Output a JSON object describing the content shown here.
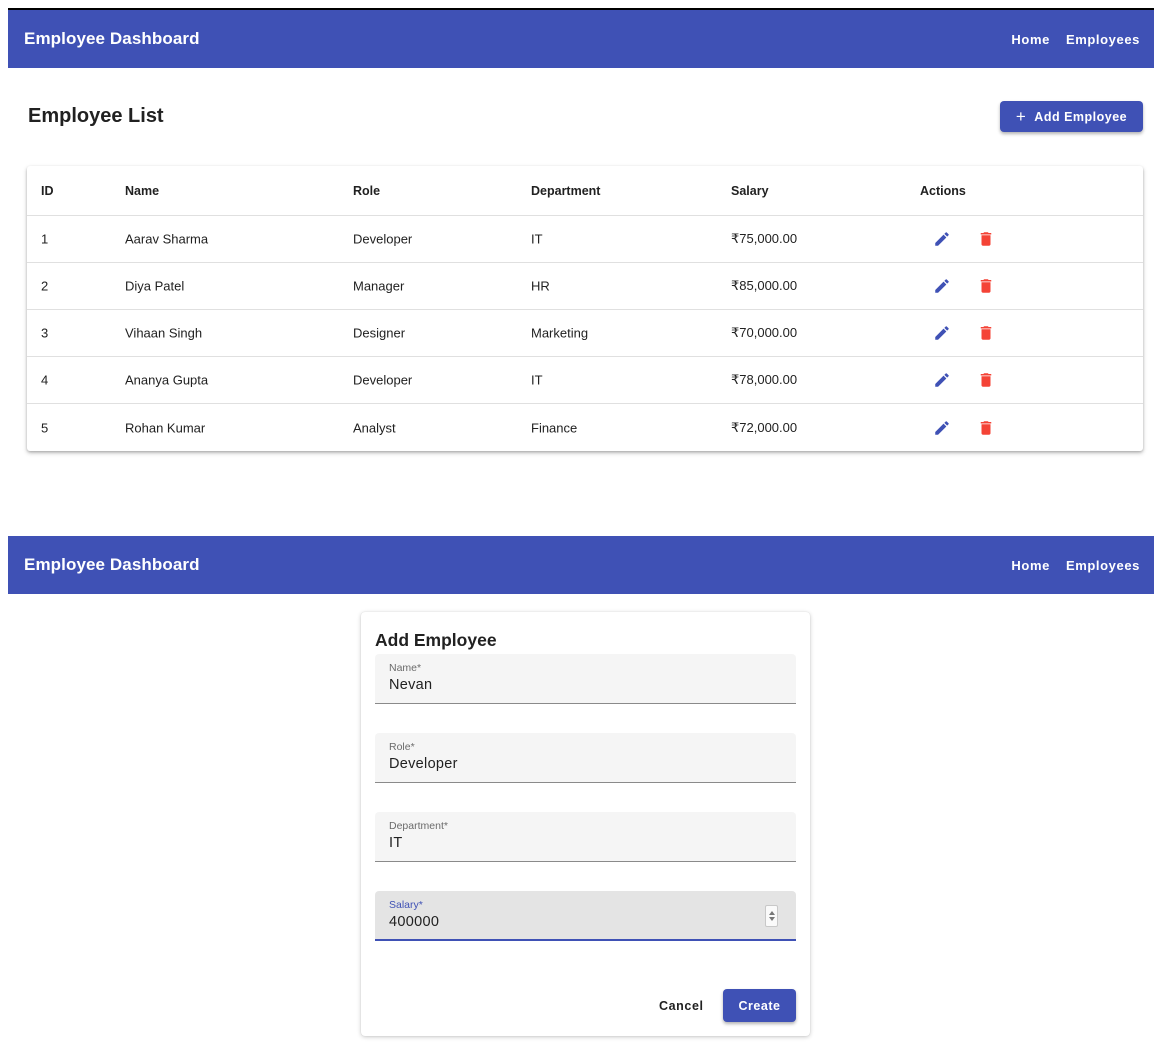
{
  "app": {
    "brand": "Employee Dashboard",
    "nav": [
      {
        "label": "Home"
      },
      {
        "label": "Employees"
      }
    ],
    "accent_color": "#3f51b5"
  },
  "list_page": {
    "title": "Employee List",
    "add_button_label": "Add Employee",
    "add_button_icon": "plus-icon",
    "columns": [
      "ID",
      "Name",
      "Role",
      "Department",
      "Salary",
      "Actions"
    ],
    "rows": [
      {
        "id": "1",
        "name": "Aarav Sharma",
        "role": "Developer",
        "department": "IT",
        "salary": "₹75,000.00"
      },
      {
        "id": "2",
        "name": "Diya Patel",
        "role": "Manager",
        "department": "HR",
        "salary": "₹85,000.00"
      },
      {
        "id": "3",
        "name": "Vihaan Singh",
        "role": "Designer",
        "department": "Marketing",
        "salary": "₹70,000.00"
      },
      {
        "id": "4",
        "name": "Ananya Gupta",
        "role": "Developer",
        "department": "IT",
        "salary": "₹78,000.00"
      },
      {
        "id": "5",
        "name": "Rohan Kumar",
        "role": "Analyst",
        "department": "Finance",
        "salary": "₹72,000.00"
      }
    ],
    "row_actions": {
      "edit_icon": "pencil-icon",
      "delete_icon": "trash-icon",
      "edit_color": "#3f51b5",
      "delete_color": "#f44336"
    }
  },
  "form_page": {
    "title": "Add Employee",
    "fields": {
      "name": {
        "label": "Name*",
        "value": "Nevan"
      },
      "role": {
        "label": "Role*",
        "value": "Developer"
      },
      "department": {
        "label": "Department*",
        "value": "IT"
      },
      "salary": {
        "label": "Salary*",
        "value": "400000"
      }
    },
    "focused_field": "salary",
    "cancel_label": "Cancel",
    "create_label": "Create"
  }
}
